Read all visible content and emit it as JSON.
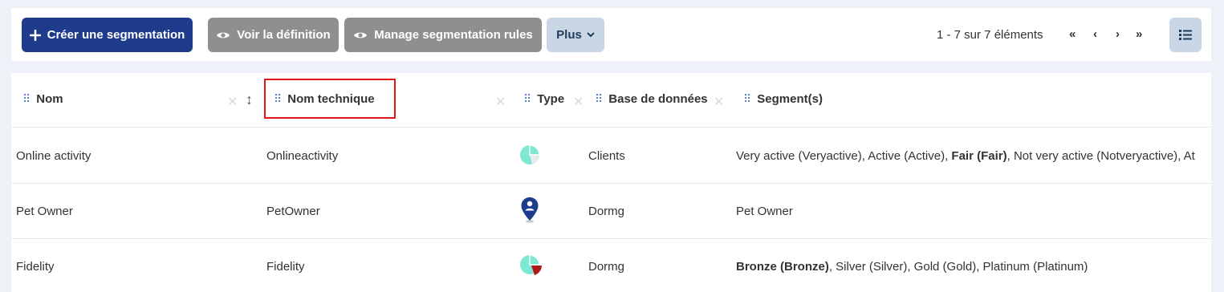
{
  "toolbar": {
    "create_label": "Créer une segmentation",
    "view_def_label": "Voir la définition",
    "manage_rules_label": "Manage segmentation rules",
    "plus_label": "Plus",
    "pager_text": "1 - 7 sur 7 éléments"
  },
  "columns": {
    "nom": "Nom",
    "nom_technique": "Nom technique",
    "type": "Type",
    "base": "Base de données",
    "segments": "Segment(s)"
  },
  "rows": [
    {
      "nom": "Online activity",
      "tech": "Onlineactivity",
      "type_icon": "pie-chart-icon",
      "base": "Clients",
      "seg_before": "Very active (Veryactive), Active (Active), ",
      "seg_bold": "Fair (Fair)",
      "seg_after": ", Not very active (Notveryactive), At"
    },
    {
      "nom": "Pet Owner",
      "tech": "PetOwner",
      "type_icon": "location-pin-icon",
      "base": "Dormg",
      "seg_before": "Pet Owner",
      "seg_bold": "",
      "seg_after": ""
    },
    {
      "nom": "Fidelity",
      "tech": "Fidelity",
      "type_icon": "pie-chart-red-icon",
      "base": "Dormg",
      "seg_before": "",
      "seg_bold": "Bronze (Bronze)",
      "seg_after": ", Silver (Silver), Gold (Gold), Platinum (Platinum)"
    }
  ],
  "colors": {
    "primary": "#1f3b8c",
    "gray_button": "#8f8f8f",
    "light_button": "#c9d6e6",
    "highlight_border": "#e01515",
    "pie_teal": "#7fe8d2"
  }
}
